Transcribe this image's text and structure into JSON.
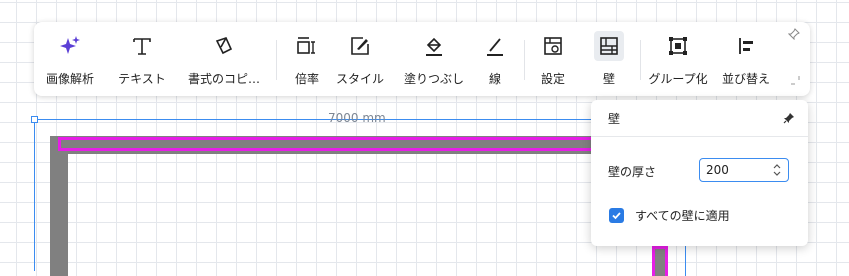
{
  "toolbar": {
    "items": [
      {
        "label": "画像解析",
        "icon": "sparkle-icon"
      },
      {
        "label": "テキスト",
        "icon": "text-icon"
      },
      {
        "label": "書式のコピ…",
        "icon": "format-painter-icon"
      },
      {
        "label": "倍率",
        "icon": "scale-icon"
      },
      {
        "label": "スタイル",
        "icon": "style-icon"
      },
      {
        "label": "塗りつぶし",
        "icon": "fill-bucket-icon"
      },
      {
        "label": "線",
        "icon": "line-icon"
      },
      {
        "label": "設定",
        "icon": "settings-icon"
      },
      {
        "label": "壁",
        "icon": "wall-icon",
        "active": true
      },
      {
        "label": "グループ化",
        "icon": "group-icon"
      },
      {
        "label": "並び替え",
        "icon": "arrange-icon"
      }
    ]
  },
  "canvas": {
    "dimension_label": "7000 mm"
  },
  "wall_panel": {
    "title": "壁",
    "thickness_label": "壁の厚さ",
    "thickness_value": "200",
    "apply_all_label": "すべての壁に適用",
    "apply_all_checked": true
  },
  "colors": {
    "accent": "#2a7be4",
    "wall": "#808080",
    "wall_selected": "#e61ee6",
    "selection": "#3b8cf0",
    "sparkle": "#5b3fd6"
  }
}
